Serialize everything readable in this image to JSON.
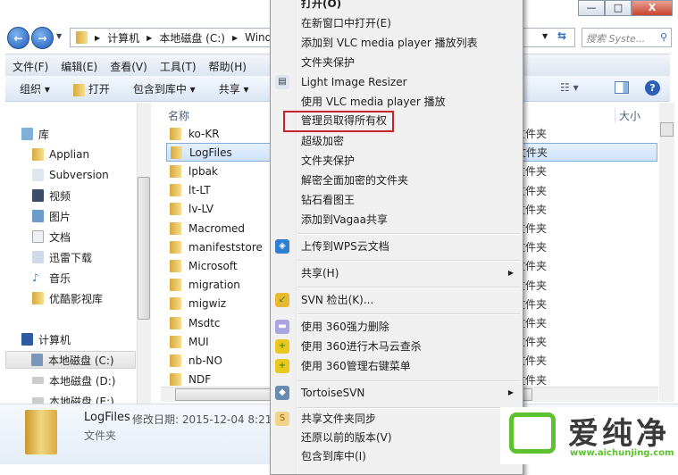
{
  "window": {
    "minimize": "—",
    "maximize": "□",
    "close": "X"
  },
  "address": {
    "parts": [
      "计算机",
      "本地磁盘 (C:)",
      "Wind"
    ],
    "search_placeholder": "搜索 Syste..."
  },
  "menubar": [
    "文件(F)",
    "编辑(E)",
    "查看(V)",
    "工具(T)",
    "帮助(H)"
  ],
  "toolbar": [
    "组织 ▾",
    "打开",
    "包含到库中 ▾",
    "共享 ▾"
  ],
  "columns": {
    "name": "名称",
    "type": "型",
    "size": "大小"
  },
  "nav": {
    "library": "库",
    "library_items": [
      "Applian",
      "Subversion",
      "视频",
      "图片",
      "文档",
      "迅雷下载",
      "音乐",
      "优酷影视库"
    ],
    "computer": "计算机",
    "drives": [
      "本地磁盘 (C:)",
      "本地磁盘 (D:)",
      "本地磁盘 (E:)"
    ]
  },
  "files": [
    {
      "name": "ko-KR",
      "type": "文件夹"
    },
    {
      "name": "LogFiles",
      "type": "文件夹",
      "selected": true
    },
    {
      "name": "lpbak",
      "type": "文件夹"
    },
    {
      "name": "lt-LT",
      "type": "文件夹"
    },
    {
      "name": "lv-LV",
      "type": "文件夹"
    },
    {
      "name": "Macromed",
      "type": "文件夹"
    },
    {
      "name": "manifeststore",
      "type": "文件夹"
    },
    {
      "name": "Microsoft",
      "type": "文件夹"
    },
    {
      "name": "migration",
      "type": "文件夹"
    },
    {
      "name": "migwiz",
      "type": "文件夹"
    },
    {
      "name": "Msdtc",
      "type": "文件夹"
    },
    {
      "name": "MUI",
      "type": "文件夹"
    },
    {
      "name": "nb-NO",
      "type": "文件夹"
    },
    {
      "name": "NDF",
      "type": "文件夹"
    }
  ],
  "details": {
    "name": "LogFiles",
    "modified": "修改日期: 2015-12-04 8:21",
    "kind": "文件夹"
  },
  "context_menu": {
    "highlight_color": "#c2262b",
    "items": [
      "打开(O)",
      "在新窗口中打开(E)",
      "添加到 VLC media player 播放列表",
      "文件夹保护",
      "Light Image Resizer",
      "使用 VLC media player 播放",
      "管理员取得所有权",
      "超级加密",
      "文件夹保护",
      "解密全面加密的文件夹",
      "钻石看图王",
      "添加到Vagaa共享",
      "上传到WPS云文档",
      "共享(H)",
      "SVN 检出(K)...",
      "使用 360强力删除",
      "使用 360进行木马云查杀",
      "使用 360管理右键菜单",
      "TortoiseSVN",
      "共享文件夹同步",
      "还原以前的版本(V)",
      "包含到库中(I)"
    ]
  },
  "watermark": {
    "brand": "爱纯净",
    "url": "www.aichunjing.com"
  }
}
